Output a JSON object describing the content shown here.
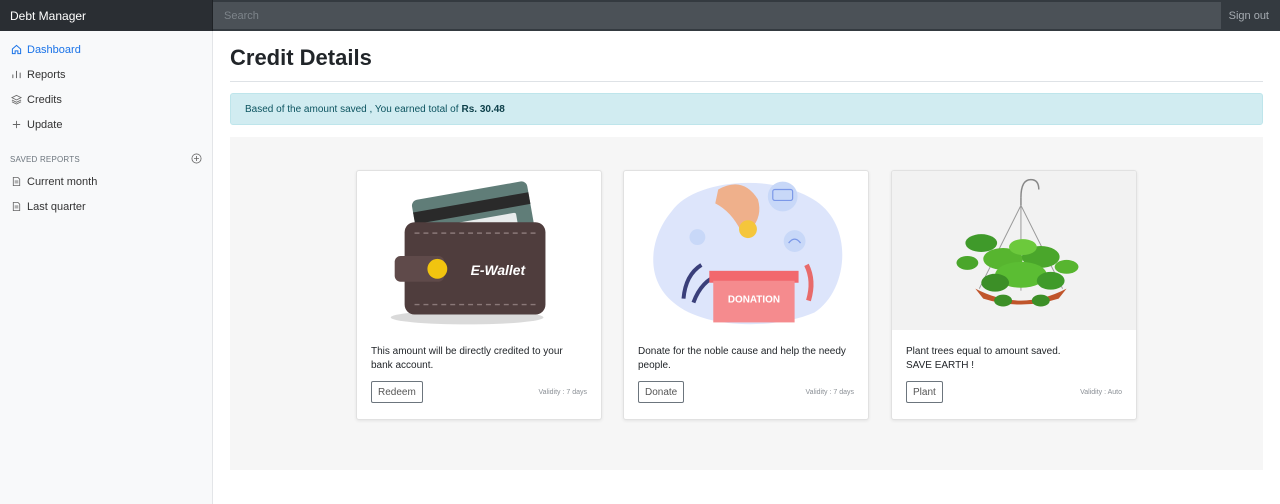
{
  "navbar": {
    "brand": "Debt Manager",
    "search_placeholder": "Search",
    "signout": "Sign out"
  },
  "sidebar": {
    "items": [
      {
        "label": "Dashboard",
        "icon": "home-icon",
        "active": true
      },
      {
        "label": "Reports",
        "icon": "bar-chart-icon"
      },
      {
        "label": "Credits",
        "icon": "layers-icon"
      },
      {
        "label": "Update",
        "icon": "plus-icon"
      }
    ],
    "saved_heading": "SAVED REPORTS",
    "saved_items": [
      {
        "label": "Current month",
        "icon": "file-icon"
      },
      {
        "label": "Last quarter",
        "icon": "file-icon"
      }
    ]
  },
  "main": {
    "title": "Credit Details",
    "alert_text": "Based of the amount saved , You earned total of",
    "alert_amount": "Rs. 30.48",
    "cards": [
      {
        "image": "e-wallet-illustration",
        "image_label": "E-Wallet",
        "text": "This amount will be directly credited to your bank account.",
        "button": "Redeem",
        "validity": "Validity : 7 days"
      },
      {
        "image": "donation-box-illustration",
        "image_label": "DONATION",
        "text": "Donate for the noble cause and help the needy people.",
        "button": "Donate",
        "validity": "Validity : 7 days"
      },
      {
        "image": "hanging-plant-illustration",
        "text_line1": "Plant trees equal to amount saved.",
        "text_line2": "SAVE EARTH !",
        "button": "Plant",
        "validity": "Validity : Auto"
      }
    ]
  },
  "colors": {
    "navbar": "#343a40",
    "accent": "#1a73e8",
    "alert_bg": "#d1ecf1"
  }
}
